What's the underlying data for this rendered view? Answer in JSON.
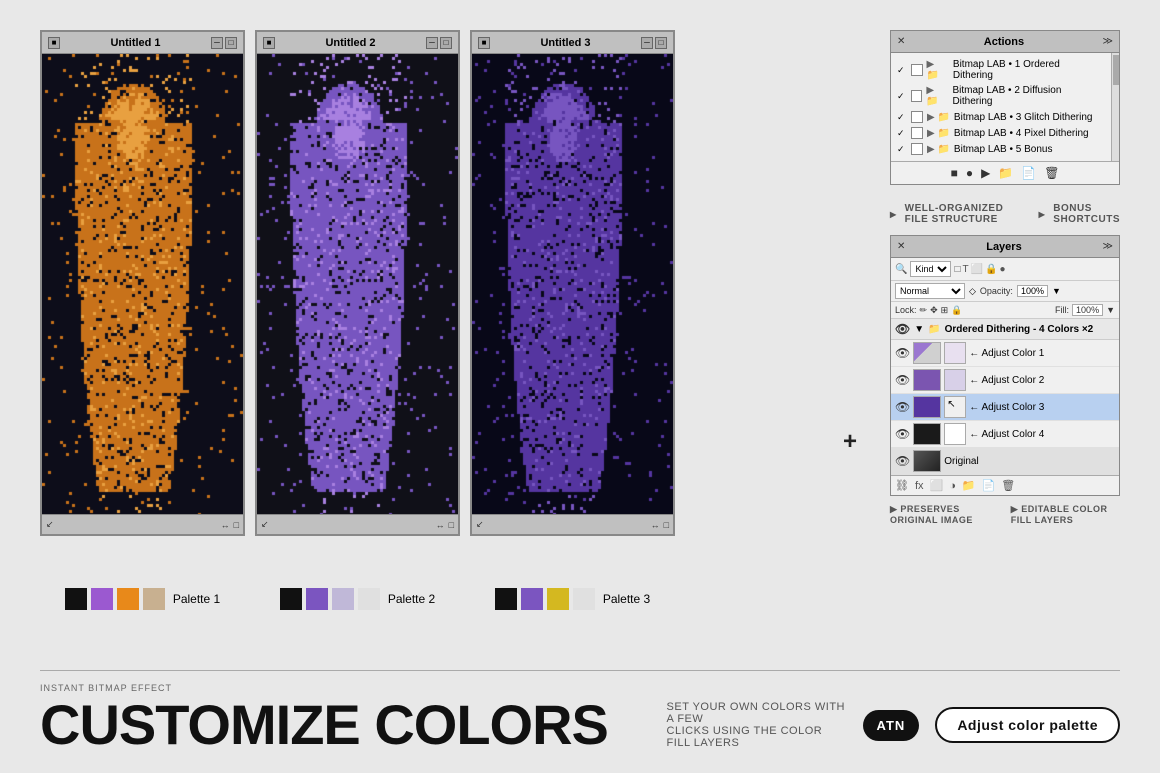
{
  "windows": [
    {
      "id": "window-1",
      "title": "Untitled 1",
      "palette_label": "Palette 1",
      "palette_colors": [
        "#111111",
        "#9b59d0",
        "#e8891a",
        "#c8b090"
      ]
    },
    {
      "id": "window-2",
      "title": "Untitled 2",
      "palette_label": "Palette 2",
      "palette_colors": [
        "#111111",
        "#7b55c0",
        "#b0a0d0",
        "#d0d0d0"
      ]
    },
    {
      "id": "window-3",
      "title": "Untitled 3",
      "palette_label": "Palette 3",
      "palette_colors": [
        "#111111",
        "#7b55c0",
        "#d4b820",
        "#d0d0d0"
      ]
    }
  ],
  "actions_panel": {
    "title": "Actions",
    "items": [
      {
        "label": "Bitmap LAB • 1 Ordered Dithering",
        "checked": true
      },
      {
        "label": "Bitmap LAB • 2 Diffusion Dithering",
        "checked": true
      },
      {
        "label": "Bitmap LAB • 3 Glitch Dithering",
        "checked": true
      },
      {
        "label": "Bitmap LAB • 4 Pixel Dithering",
        "checked": true
      },
      {
        "label": "Bitmap LAB • 5 Bonus",
        "checked": true
      }
    ],
    "toolbar_buttons": [
      "■",
      "●",
      "▶",
      "□",
      "□",
      "🗑"
    ]
  },
  "features_top": [
    {
      "label": "WELL-ORGANIZED FILE STRUCTURE"
    },
    {
      "label": "BONUS SHORTCUTS"
    }
  ],
  "layers_panel": {
    "title": "Layers",
    "blend_mode": "Normal",
    "opacity": "100%",
    "fill": "100%",
    "group_name": "Ordered Dithering - 4 Colors ×2",
    "layers": [
      {
        "name": "← Adjust Color 1",
        "color": "#9b77d0",
        "mask": "light"
      },
      {
        "name": "← Adjust Color 2",
        "color": "#7b55b0",
        "mask": "light"
      },
      {
        "name": "← Adjust Color 3",
        "color": "#5535a0",
        "mask": "dark",
        "selected": true
      },
      {
        "name": "← Adjust Color 4",
        "color": "#2a2a2a",
        "mask": "white"
      }
    ],
    "original_layer": {
      "name": "Original"
    }
  },
  "features_bottom": [
    {
      "label": "PRESERVES ORIGINAL IMAGE"
    },
    {
      "label": "EDITABLE COLOR FILL LAYERS"
    }
  ],
  "bottom": {
    "instant_label": "INSTANT BITMAP EFFECT",
    "title": "CUSTOMIZE COLORS",
    "description": "SET YOUR OWN COLORS WITH A FEW\nCLICKS USING THE COLOR FILL LAYERS",
    "badge": "ATN",
    "cta": "Adjust color palette"
  },
  "connector": "+",
  "colors": {
    "background": "#e8e8e8",
    "accent": "#7b55c0"
  }
}
